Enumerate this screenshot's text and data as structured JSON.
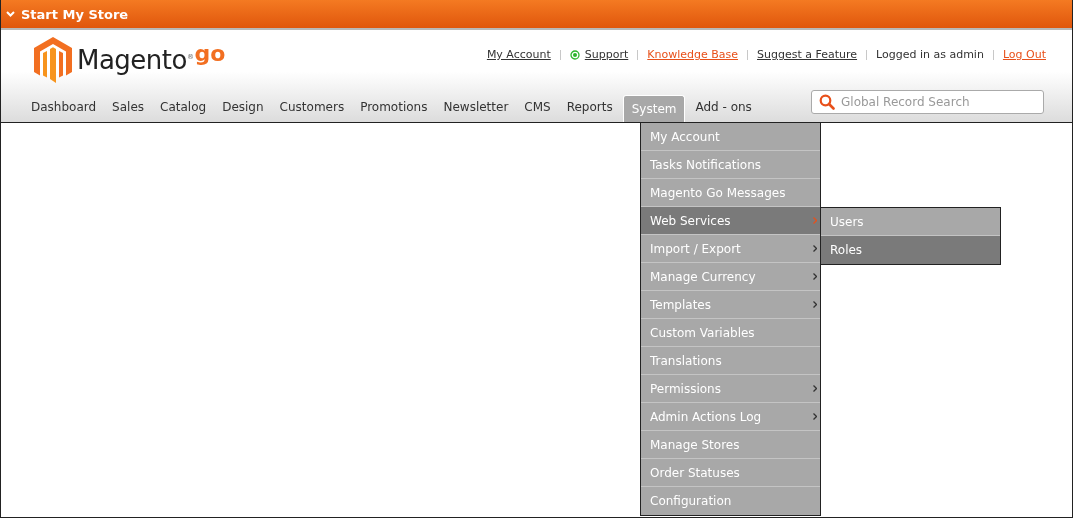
{
  "top_bar": {
    "title": "Start My Store",
    "expanded": true
  },
  "logo": {
    "name": "Magento",
    "mark": "®",
    "suffix": "go"
  },
  "header_links": [
    {
      "label": "My Account",
      "kind": "link",
      "color": "#333333"
    },
    {
      "label": "Support",
      "kind": "status-link",
      "color": "#333333"
    },
    {
      "label": "Knowledge Base",
      "kind": "link",
      "color": "#e8501a"
    },
    {
      "label": "Suggest a Feature",
      "kind": "link",
      "color": "#333333"
    },
    {
      "label": "Logged in as admin",
      "kind": "text",
      "color": "#333333"
    },
    {
      "label": "Log Out",
      "kind": "link",
      "color": "#e8501a"
    }
  ],
  "nav": [
    {
      "label": "Dashboard",
      "selected": false
    },
    {
      "label": "Sales",
      "selected": false
    },
    {
      "label": "Catalog",
      "selected": false
    },
    {
      "label": "Design",
      "selected": false
    },
    {
      "label": "Customers",
      "selected": false
    },
    {
      "label": "Promotions",
      "selected": false
    },
    {
      "label": "Newsletter",
      "selected": false
    },
    {
      "label": "CMS",
      "selected": false
    },
    {
      "label": "Reports",
      "selected": false
    },
    {
      "label": "System",
      "selected": true
    },
    {
      "label": "Add - ons",
      "selected": false
    }
  ],
  "search": {
    "placeholder": "Global Record Search"
  },
  "system_menu": [
    {
      "label": "My Account",
      "has_submenu": false,
      "selected": false
    },
    {
      "label": "Tasks Notifications",
      "has_submenu": false,
      "selected": false
    },
    {
      "label": "Magento Go Messages",
      "has_submenu": false,
      "selected": false
    },
    {
      "label": "Web Services",
      "has_submenu": true,
      "selected": true,
      "children": [
        {
          "label": "Users",
          "selected": false
        },
        {
          "label": "Roles",
          "selected": true
        }
      ]
    },
    {
      "label": "Import / Export",
      "has_submenu": true,
      "selected": false
    },
    {
      "label": "Manage Currency",
      "has_submenu": true,
      "selected": false
    },
    {
      "label": "Templates",
      "has_submenu": true,
      "selected": false
    },
    {
      "label": "Custom Variables",
      "has_submenu": false,
      "selected": false
    },
    {
      "label": "Translations",
      "has_submenu": false,
      "selected": false
    },
    {
      "label": "Permissions",
      "has_submenu": true,
      "selected": false
    },
    {
      "label": "Admin Actions Log",
      "has_submenu": true,
      "selected": false
    },
    {
      "label": "Manage Stores",
      "has_submenu": false,
      "selected": false
    },
    {
      "label": "Order Statuses",
      "has_submenu": false,
      "selected": false
    },
    {
      "label": "Configuration",
      "has_submenu": false,
      "selected": false
    }
  ]
}
